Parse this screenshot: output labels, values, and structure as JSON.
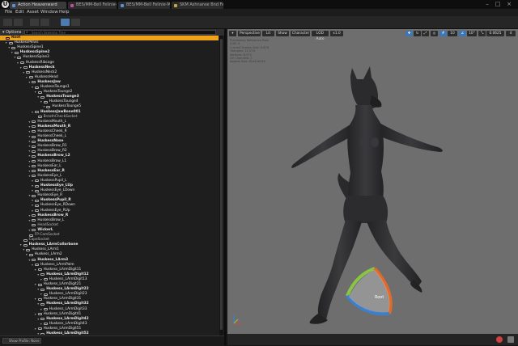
{
  "app": {
    "logo": "U"
  },
  "tabs": [
    {
      "label": "Action Heavenward",
      "color": "#5b8fd6"
    },
    {
      "label": "BES/MM-Bell Felinie-Mira",
      "color": "#c44b9e"
    },
    {
      "label": "BES/MM-Bell Felinie-Mira",
      "color": "#5b8fd6"
    },
    {
      "label": "SKM Ashnanse Bnd Fem",
      "color": "#c4a63b"
    }
  ],
  "menu": [
    "File",
    "Edit",
    "Asset",
    "Window",
    "Help"
  ],
  "left_panel": {
    "options_label": "Options",
    "search_placeholder": "Search Skeleton Tree",
    "preview_label": "Show Profile: None",
    "rows": [
      {
        "label": "Root",
        "indent": 0,
        "selected": true
      },
      {
        "label": "HuskessPelvis",
        "indent": 1
      },
      {
        "label": "HuskessSpine1",
        "indent": 2
      },
      {
        "label": "HuskessSpine2",
        "indent": 3
      },
      {
        "label": "HuskessSpine3",
        "indent": 4
      },
      {
        "label": "HuskessRibcage",
        "indent": 5
      },
      {
        "label": "HuskessNeck",
        "indent": 6
      },
      {
        "label": "HuskessNeck2",
        "indent": 7
      },
      {
        "label": "HuskessHead",
        "indent": 8
      },
      {
        "label": "HuskessJaw",
        "indent": 9
      },
      {
        "label": "HuskessTounge1",
        "indent": 10
      },
      {
        "label": "HuskessTounge2",
        "indent": 11
      },
      {
        "label": "HuskessTounge3",
        "indent": 12
      },
      {
        "label": "HuskessTounge4",
        "indent": 13
      },
      {
        "label": "HuskessTounge5",
        "indent": 14
      },
      {
        "label": "HuskessJawBone001",
        "indent": 10
      },
      {
        "label": "BreathCheckSocket",
        "indent": 11,
        "socket": true
      },
      {
        "label": "HuskessMouth_L",
        "indent": 9
      },
      {
        "label": "HuskessMouth_R",
        "indent": 9
      },
      {
        "label": "HuskessCheek_R",
        "indent": 9
      },
      {
        "label": "HuskessCheek_L",
        "indent": 9
      },
      {
        "label": "HuskessNose",
        "indent": 9
      },
      {
        "label": "HuskessBrow_R1",
        "indent": 9
      },
      {
        "label": "HuskessBrow_R2",
        "indent": 9
      },
      {
        "label": "HuskessBrow_L2",
        "indent": 9
      },
      {
        "label": "HuskessBrow_L1",
        "indent": 9
      },
      {
        "label": "HuskessEar_L",
        "indent": 9
      },
      {
        "label": "HuskessEar_R",
        "indent": 9
      },
      {
        "label": "HuskessEye_L",
        "indent": 9
      },
      {
        "label": "HuskessPupil_L",
        "indent": 10
      },
      {
        "label": "HuskessEye_LUp",
        "indent": 10
      },
      {
        "label": "HuskessEye_LDown",
        "indent": 10
      },
      {
        "label": "HuskessEye_R",
        "indent": 9
      },
      {
        "label": "HuskessPupil_R",
        "indent": 10
      },
      {
        "label": "HuskessEye_RDown",
        "indent": 10
      },
      {
        "label": "HuskessEye_RUp",
        "indent": 10
      },
      {
        "label": "HuskessBrow_R",
        "indent": 9
      },
      {
        "label": "HuskessBrow_L",
        "indent": 9
      },
      {
        "label": "HeadSocket",
        "indent": 9,
        "socket": true
      },
      {
        "label": "WickerL",
        "indent": 9
      },
      {
        "label": "FP-CamSocket",
        "indent": 8,
        "socket": true
      },
      {
        "label": "CapeSocket",
        "indent": 6,
        "socket": true
      },
      {
        "label": "Huskess_LArmCollarbone",
        "indent": 6
      },
      {
        "label": "Huskess_LArm1",
        "indent": 7
      },
      {
        "label": "Huskess_LArm2",
        "indent": 8
      },
      {
        "label": "Huskess_LArm3",
        "indent": 9
      },
      {
        "label": "Huskess_LArmPalm",
        "indent": 10
      },
      {
        "label": "Huskess_LArmDigit11",
        "indent": 11
      },
      {
        "label": "Huskess_LArmDigit12",
        "indent": 12
      },
      {
        "label": "Huskess_LArmDigit13",
        "indent": 13
      },
      {
        "label": "Huskess_LArmDigit21",
        "indent": 11
      },
      {
        "label": "Huskess_LArmDigit22",
        "indent": 12
      },
      {
        "label": "Huskess_LArmDigit23",
        "indent": 13
      },
      {
        "label": "Huskess_LArmDigit31",
        "indent": 11
      },
      {
        "label": "Huskess_LArmDigit32",
        "indent": 12
      },
      {
        "label": "Huskess_LArmDigit33",
        "indent": 13
      },
      {
        "label": "Huskess_LArmDigit41",
        "indent": 11
      },
      {
        "label": "Huskess_LArmDigit42",
        "indent": 12
      },
      {
        "label": "Huskess_LArmDigit43",
        "indent": 13
      },
      {
        "label": "Huskess_LArmDigit51",
        "indent": 11
      },
      {
        "label": "Huskess_LArmDigit52",
        "indent": 12
      }
    ]
  },
  "viewport": {
    "toolbar": {
      "perspective": "Perspective",
      "lit": "Lit",
      "show": "Show",
      "character": "Character",
      "lod": "LOD Auto",
      "speed": "x1.0",
      "grid_snap": "10",
      "rotate_snap": "10°",
      "scale_snap": "0.0625",
      "cam_speed": "4"
    },
    "info_lines": [
      "Previewing Reference Pose",
      "LOD: 0",
      "Current Screen Size: 0.874",
      "Triangles: 12,574",
      "Vertices: 8,071",
      "UV Channels: 1",
      "Approx Size: 81x43x215"
    ],
    "gizmo_label": "Root",
    "colors": {
      "background": "#6e6e6e",
      "mesh": "#2c2c2e",
      "selection": "#f0a31a",
      "gizmo_green": "#8ac444",
      "gizmo_blue": "#3e7fcc",
      "gizmo_red": "#e06a2a"
    }
  }
}
